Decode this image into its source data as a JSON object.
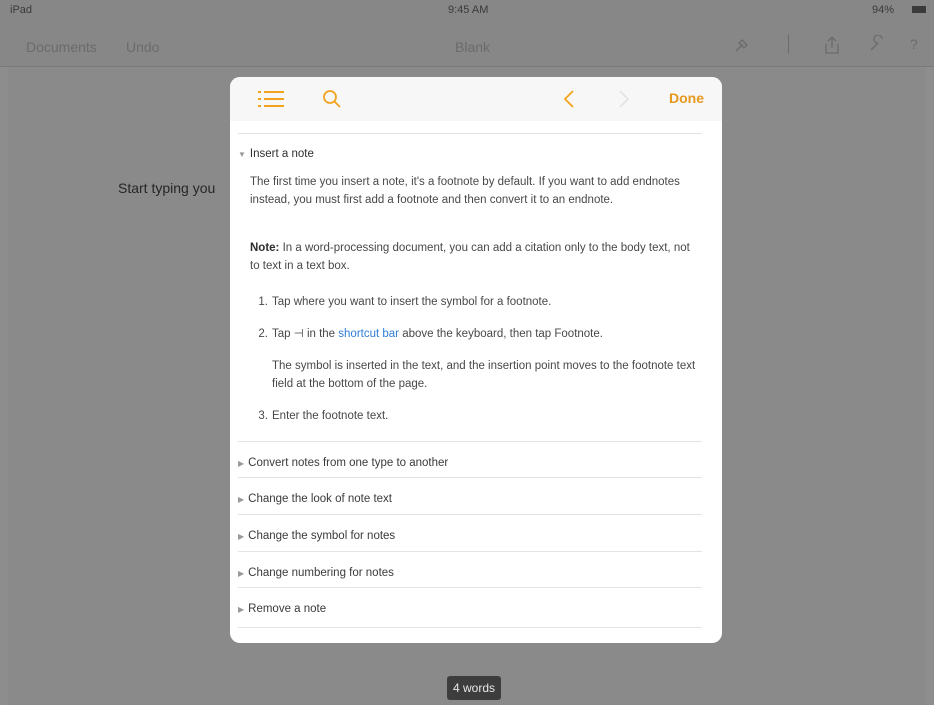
{
  "status": {
    "carrier": "iPad",
    "time": "9:45 AM",
    "battery": "94%"
  },
  "toolbar": {
    "documents": "Documents",
    "undo": "Undo",
    "title": "Blank",
    "icons": [
      "format-brush-icon",
      "insert-icon",
      "share-icon",
      "tools-wrench-icon",
      "help-icon"
    ]
  },
  "document": {
    "text": "Start typing you"
  },
  "word_count": "4 words",
  "popover": {
    "done": "Done",
    "icons": [
      "toc-list-icon",
      "search-icon",
      "back-chevron-icon",
      "forward-chevron-icon"
    ],
    "accent_color": "#F2A31D",
    "section": {
      "title": "Insert a note",
      "intro": "The first time you insert a note, it's a footnote by default. If you want to add endnotes instead, you must first add a footnote and then convert it to an endnote.",
      "note_label": "Note:",
      "note_text": " In a word-processing document, you can add a citation only to the body text, not to text in a text box.",
      "steps": [
        {
          "num": "1.",
          "text": "Tap where you want to insert the symbol for a footnote."
        },
        {
          "num": "2.",
          "pre": "Tap ⊣ in the ",
          "link": "shortcut bar",
          "post": " above the keyboard, then tap Footnote."
        },
        {
          "num": "3.",
          "text": "Enter the footnote text."
        }
      ],
      "step2_result": "The symbol is inserted in the text, and the insertion point moves to the footnote text field at the bottom of the page."
    },
    "collapsed_sections": [
      "Convert notes from one type to another",
      "Change the look of note text",
      "Change the symbol for notes",
      "Change numbering for notes",
      "Remove a note"
    ]
  }
}
